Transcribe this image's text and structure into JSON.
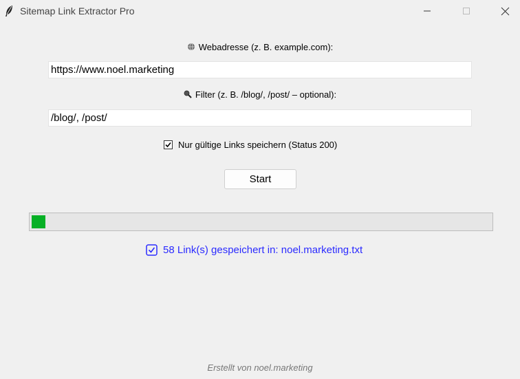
{
  "window": {
    "title": "Sitemap Link Extractor Pro",
    "icon": "feather-icon"
  },
  "url": {
    "label": "Webadresse (z. B. example.com):",
    "icon": "globe-icon",
    "value": "https://www.noel.marketing"
  },
  "filter": {
    "label": "Filter (z. B. /blog/, /post/ – optional):",
    "icon": "magnifier-icon",
    "value": "/blog/, /post/"
  },
  "valid_only": {
    "label": "Nur gültige Links speichern (Status 200)",
    "checked": true
  },
  "start_button": {
    "label": "Start"
  },
  "progress": {
    "fraction": 0.03,
    "color": "#06b025"
  },
  "status": {
    "text": "58 Link(s) gespeichert in: noel.marketing.txt",
    "icon": "check-box-icon",
    "color": "#2a2aff"
  },
  "footer": {
    "text": "Erstellt von noel.marketing"
  }
}
